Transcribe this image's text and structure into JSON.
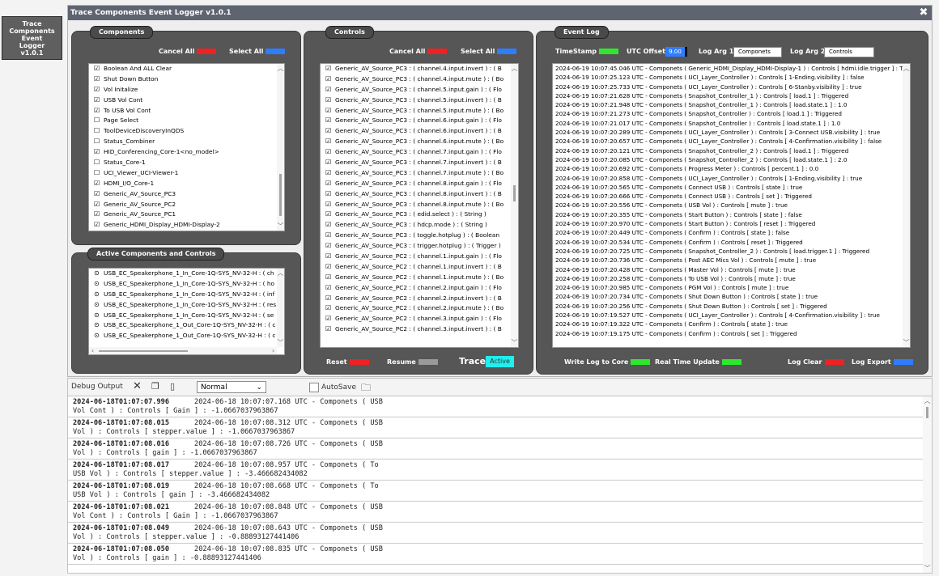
{
  "side_tile": {
    "line1": "Trace",
    "line2": "Components",
    "line3": "Event",
    "line4": "Logger",
    "line5": "v1.0.1"
  },
  "window": {
    "title": "Trace Components Event Logger v1.0.1"
  },
  "colors": {
    "cancel": "#ee2222",
    "select": "#2f7dff",
    "reset": "#ee2222",
    "resume": "#9a9a9a",
    "active": "#22eeee",
    "green": "#2ee82e",
    "log_export": "#2f7dff"
  },
  "components": {
    "title": "Components",
    "cancel_all": "Cancel All",
    "select_all": "Select All",
    "items": [
      {
        "check": "☑",
        "label": "Boolean And ALL Clear"
      },
      {
        "check": "☑",
        "label": "Shut Down Button"
      },
      {
        "check": "☑",
        "label": "Vol Initalize"
      },
      {
        "check": "☑",
        "label": "USB Vol Cont"
      },
      {
        "check": "☑",
        "label": "To USB Vol Cont"
      },
      {
        "check": "☐",
        "label": "Page Select"
      },
      {
        "check": "☐",
        "label": "ToolDeviceDiscoveryInQDS"
      },
      {
        "check": "☐",
        "label": "Status_Combiner"
      },
      {
        "check": "☑",
        "label": "HID_Conferencing_Core-1<no_model>"
      },
      {
        "check": "☐",
        "label": "Status_Core-1"
      },
      {
        "check": "☐",
        "label": "UCI_Viewer_UCI-Viewer-1"
      },
      {
        "check": "☑",
        "label": "HDMI_I/O_Core-1"
      },
      {
        "check": "☑",
        "label": "Generic_AV_Source_PC3"
      },
      {
        "check": "☑",
        "label": "Generic_AV_Source_PC2"
      },
      {
        "check": "☑",
        "label": "Generic_AV_Source_PC1"
      },
      {
        "check": "☑",
        "label": "Generic_HDMI_Display_HDMI-Display-2"
      }
    ]
  },
  "active": {
    "title": "Active Components and Controls",
    "items": [
      {
        "mark": "⊙",
        "label": "USB_EC_Speakerphone_1_In_Core-1Q-SYS_NV-32-H : ( ch"
      },
      {
        "mark": "⊙",
        "label": "USB_EC_Speakerphone_1_In_Core-1Q-SYS_NV-32-H : ( ho"
      },
      {
        "mark": "⊙",
        "label": "USB_EC_Speakerphone_1_In_Core-1Q-SYS_NV-32-H : ( inf"
      },
      {
        "mark": "⊙",
        "label": "USB_EC_Speakerphone_1_In_Core-1Q-SYS_NV-32-H : ( res"
      },
      {
        "mark": "⊙",
        "label": "USB_EC_Speakerphone_1_In_Core-1Q-SYS_NV-32-H : ( se"
      },
      {
        "mark": "⊙",
        "label": "USB_EC_Speakerphone_1_Out_Core-1Q-SYS_NV-32-H : ( c"
      },
      {
        "mark": "⊙",
        "label": "USB_EC_Speakerphone_1_Out_Core-1Q-SYS_NV-32-H : ( c"
      }
    ]
  },
  "controls": {
    "title": "Controls",
    "cancel_all": "Cancel All",
    "select_all": "Select All",
    "reset": "Reset",
    "resume": "Resume",
    "trace": "Trace",
    "active": "Active",
    "items": [
      {
        "check": "☑",
        "label": "Generic_AV_Source_PC3 : ( channel.4.input.invert ) : ( B"
      },
      {
        "check": "☑",
        "label": "Generic_AV_Source_PC3 : ( channel.4.input.mute ) : ( Bo"
      },
      {
        "check": "☑",
        "label": "Generic_AV_Source_PC3 : ( channel.5.input.gain ) : ( Flo"
      },
      {
        "check": "☑",
        "label": "Generic_AV_Source_PC3 : ( channel.5.input.invert ) : ( B"
      },
      {
        "check": "☑",
        "label": "Generic_AV_Source_PC3 : ( channel.5.input.mute ) : ( Bo"
      },
      {
        "check": "☑",
        "label": "Generic_AV_Source_PC3 : ( channel.6.input.gain ) : ( Flo"
      },
      {
        "check": "☑",
        "label": "Generic_AV_Source_PC3 : ( channel.6.input.invert ) : ( B"
      },
      {
        "check": "☑",
        "label": "Generic_AV_Source_PC3 : ( channel.6.input.mute ) : ( Bo"
      },
      {
        "check": "☑",
        "label": "Generic_AV_Source_PC3 : ( channel.7.input.gain ) : ( Flo"
      },
      {
        "check": "☑",
        "label": "Generic_AV_Source_PC3 : ( channel.7.input.invert ) : ( B"
      },
      {
        "check": "☑",
        "label": "Generic_AV_Source_PC3 : ( channel.7.input.mute ) : ( Bo"
      },
      {
        "check": "☑",
        "label": "Generic_AV_Source_PC3 : ( channel.8.input.gain ) : ( Flo"
      },
      {
        "check": "☑",
        "label": "Generic_AV_Source_PC3 : ( channel.8.input.invert ) : ( B"
      },
      {
        "check": "☑",
        "label": "Generic_AV_Source_PC3 : ( channel.8.input.mute ) : ( Bo"
      },
      {
        "check": "☑",
        "label": "Generic_AV_Source_PC3 : ( edid.select ) : ( String )"
      },
      {
        "check": "☑",
        "label": "Generic_AV_Source_PC3 : ( hdcp.mode ) : ( String )"
      },
      {
        "check": "☑",
        "label": "Generic_AV_Source_PC3 : ( toggle.hotplug ) : ( Boolean"
      },
      {
        "check": "☑",
        "label": "Generic_AV_Source_PC3 : ( trigger.hotplug ) : ( Trigger )"
      },
      {
        "check": "☑",
        "label": "Generic_AV_Source_PC2 : ( channel.1.input.gain ) : ( Flo"
      },
      {
        "check": "☑",
        "label": "Generic_AV_Source_PC2 : ( channel.1.input.invert ) : ( B"
      },
      {
        "check": "☑",
        "label": "Generic_AV_Source_PC2 : ( channel.1.input.mute ) : ( Bo"
      },
      {
        "check": "☑",
        "label": "Generic_AV_Source_PC2 : ( channel.2.input.gain ) : ( Flo"
      },
      {
        "check": "☑",
        "label": "Generic_AV_Source_PC2 : ( channel.2.input.invert ) : ( B"
      },
      {
        "check": "☑",
        "label": "Generic_AV_Source_PC2 : ( channel.2.input.mute ) : ( Bo"
      },
      {
        "check": "☑",
        "label": "Generic_AV_Source_PC2 : ( channel.3.input.gain ) : ( Flo"
      },
      {
        "check": "☑",
        "label": "Generic_AV_Source_PC2 : ( channel.3.input.invert ) : ( B"
      }
    ]
  },
  "eventlog": {
    "title": "Event Log",
    "timestamp": "TimeStamp",
    "utc_offset": "UTC Offset",
    "utc_value": "9.00",
    "log_arg1": "Log Arg 1",
    "log_arg1_value": "Componets",
    "log_arg2": "Log Arg 2",
    "log_arg2_value": "Controls",
    "write_log": "Write Log to Core",
    "realtime": "Real Time Update",
    "log_clear": "Log Clear",
    "log_export": "Log Export",
    "rows": [
      "2024-06-19 10:07:45.046 UTC - Componets ( Generic_HDMI_Display_HDMI-Display-1 ) : Controls [ hdmi.idle.trigger ] : Tri",
      "2024-06-19 10:07:25.123 UTC - Componets ( UCI_Layer_Controller ) : Controls [ 1-Ending.visibility ] : false",
      "2024-06-19 10:07:25.733 UTC - Componets ( UCI_Layer_Controller ) : Controls [ 6-Stanby.visibility ] : true",
      "2024-06-19 10:07:21.628 UTC - Componets ( Snapshot_Controller_1 ) : Controls [ load.1 ] : Triggered",
      "2024-06-19 10:07:21.948 UTC - Componets ( Snapshot_Controller_1 ) : Controls [ load.state.1 ] : 1.0",
      "2024-06-19 10:07:21.273 UTC - Componets ( Snapshot_Controller ) : Controls [ load.1 ] : Triggered",
      "2024-06-19 10:07:21.017 UTC - Componets ( Snapshot_Controller ) : Controls [ load.state.1 ] : 1.0",
      "2024-06-19 10:07:20.289 UTC - Componets ( UCI_Layer_Controller ) : Controls [ 3-Connect USB.visibility ] : true",
      "2024-06-19 10:07:20.657 UTC - Componets ( UCI_Layer_Controller ) : Controls [ 4-Confirmation.visibility ] : false",
      "2024-06-19 10:07:20.121 UTC - Componets ( Snapshot_Controller_2 ) : Controls [ load.1 ] : Triggered",
      "2024-06-19 10:07:20.085 UTC - Componets ( Snapshot_Controller_2 ) : Controls [ load.state.1 ] : 2.0",
      "2024-06-19 10:07:20.692 UTC - Componets ( Progress Meter ) : Controls [ percent.1 ] : 0.0",
      "2024-06-19 10:07:20.858 UTC - Componets ( UCI_Layer_Controller ) : Controls [ 1-Ending.visibility ] : true",
      "2024-06-19 10:07:20.565 UTC - Componets ( Connect USB ) : Controls [ state ] : true",
      "2024-06-19 10:07:20.666 UTC - Componets ( Connect USB ) : Controls [ set ] : Triggered",
      "2024-06-19 10:07:20.556 UTC - Componets ( USB Vol ) : Controls [ mute ] : true",
      "2024-06-19 10:07:20.355 UTC - Componets ( Start Button ) : Controls [ state ] : false",
      "2024-06-19 10:07:20.970 UTC - Componets ( Start Button ) : Controls [ reset ] : Triggered",
      "2024-06-19 10:07:20.449 UTC - Componets ( Confirm ) : Controls [ state ] : false",
      "2024-06-19 10:07:20.534 UTC - Componets ( Confirm ) : Controls [ reset ] : Triggered",
      "2024-06-19 10:07:20.725 UTC - Componets ( Snapshot_Controller_2 ) : Controls [ load.trigger.1 ] : Triggered",
      "2024-06-19 10:07:20.736 UTC - Componets ( Post AEC Mics Vol ) : Controls [ mute ] : true",
      "2024-06-19 10:07:20.428 UTC - Componets ( Master Vol ) : Controls [ mute ] : true",
      "2024-06-19 10:07:20.258 UTC - Componets ( To USB Vol ) : Controls [ mute ] : true",
      "2024-06-19 10:07:20.985 UTC - Componets ( PGM Vol ) : Controls [ mute ] : true",
      "2024-06-19 10:07:20.734 UTC - Componets ( Shut Down Button ) : Controls [ state ] : true",
      "2024-06-19 10:07:20.256 UTC - Componets ( Shut Down Button ) : Controls [ set ] : Triggered",
      "2024-06-19 10:07:19.527 UTC - Componets ( UCI_Layer_Controller ) : Controls [ 4-Confirmation.visibility ] : true",
      "2024-06-19 10:07:19.322 UTC - Componets ( Confirm ) : Controls [ state ] : true",
      "2024-06-19 10:07:19.175 UTC - Componets ( Confirm ) : Controls [ set ] : Triggered"
    ]
  },
  "debug": {
    "title": "Debug Output",
    "mode": "Normal",
    "autosave": "AutoSave",
    "entries": [
      {
        "ts": "2024-06-18T01:07:07.996",
        "l1": "      2024-06-18 10:07:07.168 UTC - Componets ( USB",
        "l2": "Vol Cont ) : Controls [ Gain ] : -1.0667037963867"
      },
      {
        "ts": "2024-06-18T01:07:08.015",
        "l1": "      2024-06-18 10:07:08.312 UTC - Componets ( USB",
        "l2": "Vol ) : Controls [ stepper.value ] : -1.0667037963867"
      },
      {
        "ts": "2024-06-18T01:07:08.016",
        "l1": "      2024-06-18 10:07:08.726 UTC - Componets ( USB",
        "l2": "Vol ) : Controls [ gain ] : -1.0667037963867"
      },
      {
        "ts": "2024-06-18T01:07:08.017",
        "l1": "      2024-06-18 10:07:08.957 UTC - Componets ( To",
        "l2": "USB Vol ) : Controls [ stepper.value ] : -3.466682434082"
      },
      {
        "ts": "2024-06-18T01:07:08.019",
        "l1": "      2024-06-18 10:07:08.668 UTC - Componets ( To",
        "l2": "USB Vol ) : Controls [ gain ] : -3.466682434082"
      },
      {
        "ts": "2024-06-18T01:07:08.021",
        "l1": "      2024-06-18 10:07:08.848 UTC - Componets ( USB",
        "l2": "Vol Cont ) : Controls [ Gain ] : -1.0667037963867"
      },
      {
        "ts": "2024-06-18T01:07:08.049",
        "l1": "      2024-06-18 10:07:08.643 UTC - Componets ( USB",
        "l2": "Vol ) : Controls [ stepper.value ] : -0.88893127441406"
      },
      {
        "ts": "2024-06-18T01:07:08.050",
        "l1": "      2024-06-18 10:07:08.835 UTC - Componets ( USB",
        "l2": "Vol ) : Controls [ gain ] : -0.88893127441406"
      }
    ]
  }
}
